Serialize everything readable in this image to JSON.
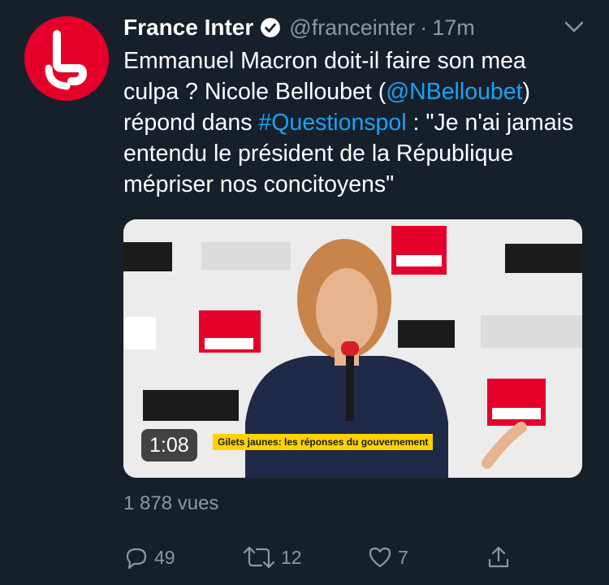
{
  "tweet": {
    "author_name": "France Inter",
    "handle": "@franceinter",
    "separator": "·",
    "time": "17m",
    "verified_icon": "verified-badge-icon",
    "menu_icon": "chevron-down-icon",
    "text_parts": {
      "p1": "Emmanuel Macron doit-il faire son mea culpa ? Nicole Belloubet (",
      "mention": "@NBelloubet",
      "p2": ") répond dans ",
      "hashtag": "#Questionspol",
      "p3": " : \"Je n'ai jamais entendu le président de la République mépriser nos concitoyens\""
    },
    "media": {
      "duration": "1:08",
      "banner": "Gilets jaunes: les réponses du gouvernement"
    },
    "views": "1 878 vues",
    "actions": {
      "reply": {
        "icon": "reply-icon",
        "count": "49"
      },
      "retweet": {
        "icon": "retweet-icon",
        "count": "12"
      },
      "like": {
        "icon": "heart-icon",
        "count": "7"
      },
      "share": {
        "icon": "share-icon"
      }
    }
  },
  "colors": {
    "background": "#15202b",
    "text": "#ffffff",
    "muted": "#8899a6",
    "link": "#1da1f2",
    "brand_red": "#e4002b"
  }
}
